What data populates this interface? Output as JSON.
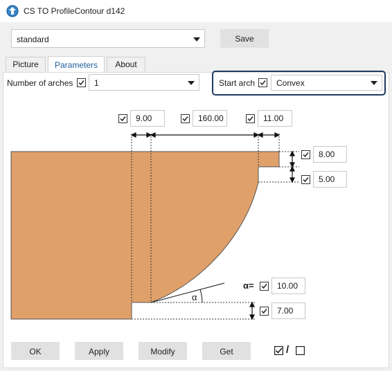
{
  "window": {
    "title": "CS TO ProfileContour d142",
    "app_icon": "cs-app-icon"
  },
  "profile": {
    "selected": "standard"
  },
  "save_label": "Save",
  "tabs": [
    {
      "label": "Picture",
      "active": false
    },
    {
      "label": "Parameters",
      "active": true
    },
    {
      "label": "About",
      "active": false
    }
  ],
  "params": {
    "num_arches_label": "Number of arches",
    "num_arches_checked": true,
    "num_arches_value": "1",
    "start_arch_label": "Start arch",
    "start_arch_checked": true,
    "start_arch_value": "Convex"
  },
  "dimensions": {
    "top_left": "9.00",
    "top_middle": "160.00",
    "top_right": "11.00",
    "right_upper": "8.00",
    "right_lower": "5.00",
    "alpha_label": "α=",
    "alpha_value": "10.00",
    "bottom_step": "7.00",
    "alpha_symbol": "α"
  },
  "footer": {
    "ok": "OK",
    "apply": "Apply",
    "modify": "Modify",
    "get": "Get",
    "toggle_sep": "/"
  },
  "colors": {
    "shape_fill": "#dfa06a",
    "accent": "#1d5e9a",
    "highlight_border": "#1e3a5f"
  }
}
